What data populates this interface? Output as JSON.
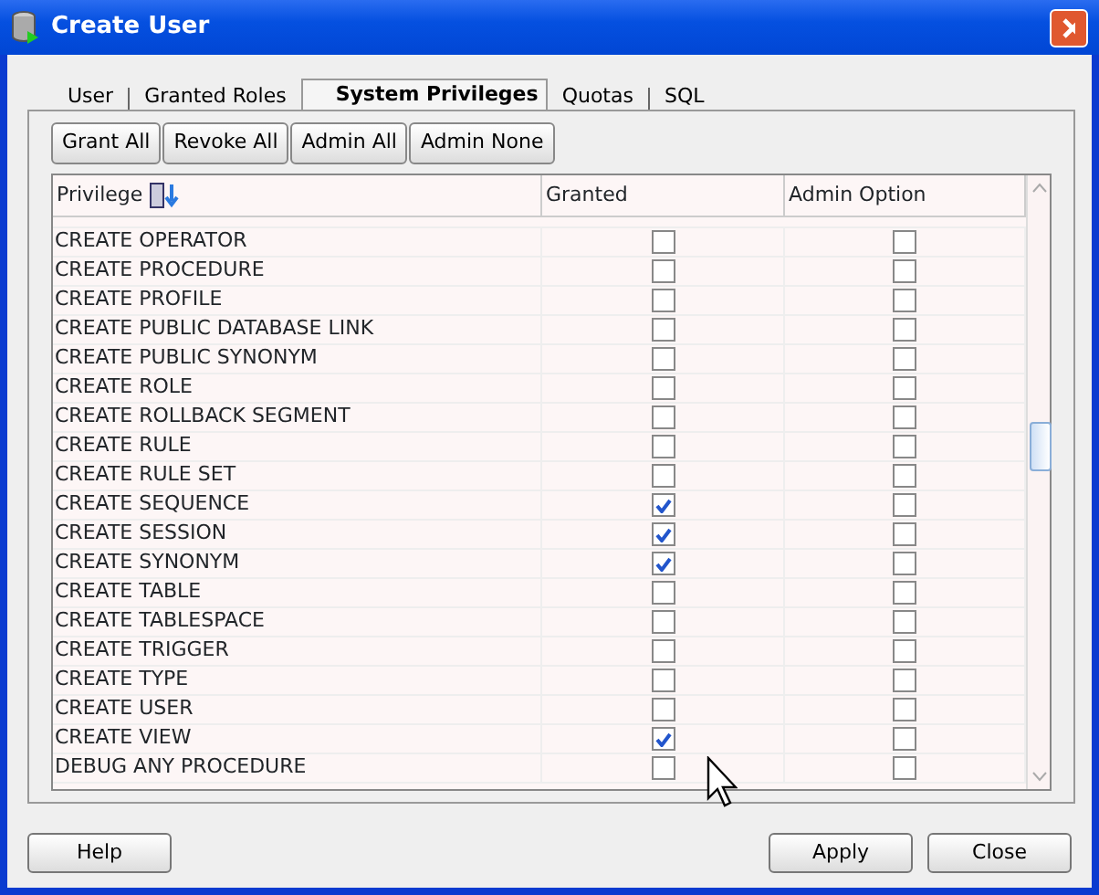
{
  "window": {
    "title": "Create User"
  },
  "tabs": [
    {
      "label": "User",
      "selected": false
    },
    {
      "label": "Granted Roles",
      "selected": false
    },
    {
      "label": "System Privileges",
      "selected": true
    },
    {
      "label": "Quotas",
      "selected": false
    },
    {
      "label": "SQL",
      "selected": false
    }
  ],
  "toolbar": [
    "Grant All",
    "Revoke All",
    "Admin All",
    "Admin None"
  ],
  "table": {
    "columns": [
      "Privilege",
      "Granted",
      "Admin Option"
    ],
    "rows": [
      {
        "privilege": "CREATE OPERATOR",
        "granted": false,
        "admin_option": false
      },
      {
        "privilege": "CREATE PROCEDURE",
        "granted": false,
        "admin_option": false
      },
      {
        "privilege": "CREATE PROFILE",
        "granted": false,
        "admin_option": false
      },
      {
        "privilege": "CREATE PUBLIC DATABASE LINK",
        "granted": false,
        "admin_option": false
      },
      {
        "privilege": "CREATE PUBLIC SYNONYM",
        "granted": false,
        "admin_option": false
      },
      {
        "privilege": "CREATE ROLE",
        "granted": false,
        "admin_option": false
      },
      {
        "privilege": "CREATE ROLLBACK SEGMENT",
        "granted": false,
        "admin_option": false
      },
      {
        "privilege": "CREATE RULE",
        "granted": false,
        "admin_option": false
      },
      {
        "privilege": "CREATE RULE SET",
        "granted": false,
        "admin_option": false
      },
      {
        "privilege": "CREATE SEQUENCE",
        "granted": true,
        "admin_option": false
      },
      {
        "privilege": "CREATE SESSION",
        "granted": true,
        "admin_option": false
      },
      {
        "privilege": "CREATE SYNONYM",
        "granted": true,
        "admin_option": false
      },
      {
        "privilege": "CREATE TABLE",
        "granted": false,
        "admin_option": false
      },
      {
        "privilege": "CREATE TABLESPACE",
        "granted": false,
        "admin_option": false
      },
      {
        "privilege": "CREATE TRIGGER",
        "granted": false,
        "admin_option": false
      },
      {
        "privilege": "CREATE TYPE",
        "granted": false,
        "admin_option": false
      },
      {
        "privilege": "CREATE USER",
        "granted": false,
        "admin_option": false
      },
      {
        "privilege": "CREATE VIEW",
        "granted": true,
        "admin_option": false
      },
      {
        "privilege": "DEBUG ANY PROCEDURE",
        "granted": false,
        "admin_option": false
      }
    ]
  },
  "footer_buttons": {
    "left": [
      "Help"
    ],
    "right": [
      "Apply",
      "Close"
    ]
  }
}
